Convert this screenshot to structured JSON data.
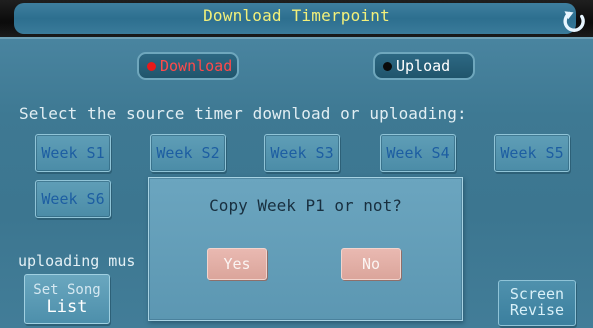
{
  "title": "Download Timerpoint",
  "icons": {
    "return": "return-arrow-icon"
  },
  "colors": {
    "title_text": "#f3f07a",
    "download_label": "#ff4a4a",
    "download_dot": "#e81a1a",
    "upload_label": "#ffffff",
    "upload_dot": "#0a0a0a",
    "week_button_text": "#1d5ea2",
    "dialog_button_bg": "#e0aba1"
  },
  "mode": {
    "download_label": "Download",
    "upload_label": "Upload",
    "selected": "Download"
  },
  "instruction": "Select the source timer download or uploading:",
  "week_buttons": [
    "Week S1",
    "Week S2",
    "Week S3",
    "Week S4",
    "Week S5",
    "Week S6"
  ],
  "background_text": "uploading mus",
  "song_list_button": {
    "line1": "Set Song",
    "line2": "List"
  },
  "screen_revise_button": {
    "line1": "Screen",
    "line2": "Revise"
  },
  "dialog": {
    "message": "Copy Week P1 or not?",
    "yes_label": "Yes",
    "no_label": "No"
  }
}
